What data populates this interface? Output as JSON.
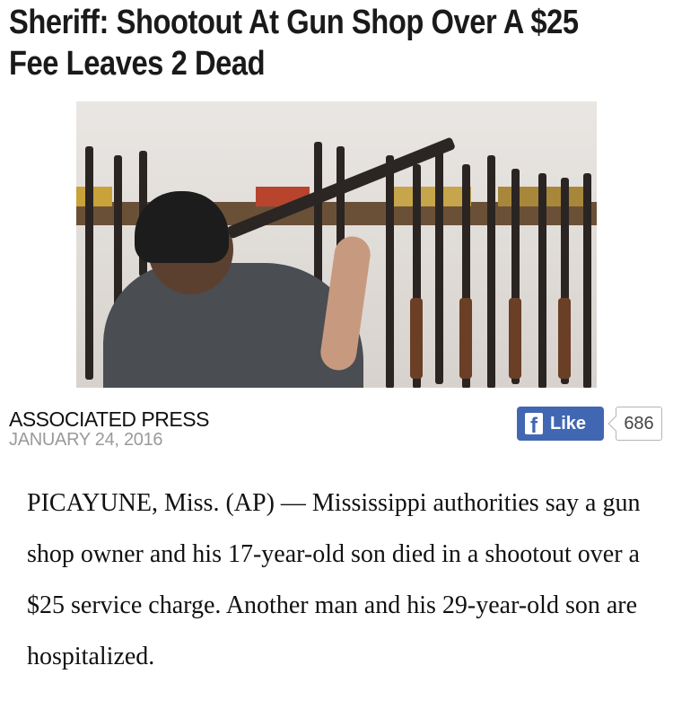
{
  "article": {
    "title": "Sheriff: Shootout At Gun Shop Over A $25 Fee Leaves 2 Dead",
    "agency": "ASSOCIATED PRESS",
    "date": "JANUARY 24, 2016",
    "body": "PICAYUNE, Miss. (AP) — Mississippi authorities say a gun shop owner and his 17-year-old son died in a shootout over a $25 service charge. Another man and his 29-year-old son are hospitalized."
  },
  "social": {
    "like_label": "Like",
    "like_count": "686",
    "icon": "facebook-icon",
    "brand_color": "#4267b2"
  }
}
